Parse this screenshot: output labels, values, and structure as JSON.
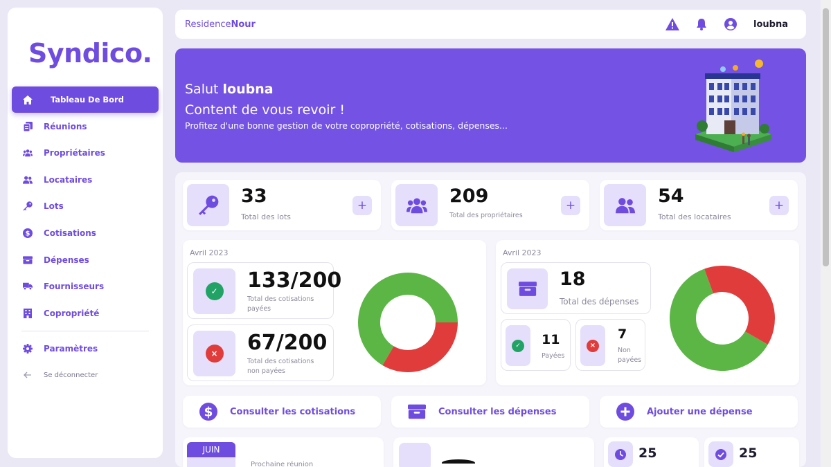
{
  "brand": {
    "logo": "Syndico."
  },
  "sidebar": {
    "items": [
      {
        "label": "Tableau De Bord",
        "icon": "home-icon",
        "active": true
      },
      {
        "label": "Réunions",
        "icon": "documents-icon"
      },
      {
        "label": "Propriétaires",
        "icon": "users-group-icon"
      },
      {
        "label": "Locataires",
        "icon": "users-icon"
      },
      {
        "label": "Lots",
        "icon": "key-icon"
      },
      {
        "label": "Cotisations",
        "icon": "dollar-circle-icon"
      },
      {
        "label": "Dépenses",
        "icon": "inbox-icon"
      },
      {
        "label": "Fournisseurs",
        "icon": "truck-icon"
      },
      {
        "label": "Copropriété",
        "icon": "building-icon"
      }
    ],
    "settings": "Paramètres",
    "logout": "Se déconnecter"
  },
  "topbar": {
    "residence_prefix": "Residence",
    "residence_name": "Nour",
    "username": "loubna"
  },
  "banner": {
    "greeting": "Salut",
    "name": "loubna",
    "subtitle": "Content de vous revoir !",
    "description": "Profitez d'une bonne gestion de votre copropriété, cotisations, dépenses..."
  },
  "stats": [
    {
      "value": "33",
      "label": "Total des lots",
      "icon": "key-icon"
    },
    {
      "value": "209",
      "label": "Total des propriétaires",
      "icon": "users-group-icon"
    },
    {
      "value": "54",
      "label": "Total des locataires",
      "icon": "users-icon"
    }
  ],
  "cotisations": {
    "month": "Avril 2023",
    "paid": {
      "value": "133/200",
      "label1": "Total des cotisations",
      "label2": "payées"
    },
    "unpaid": {
      "value": "67/200",
      "label1": "Total des cotisations",
      "label2": "non payées"
    },
    "donut": {
      "paid": 133,
      "unpaid": 67
    }
  },
  "depenses": {
    "month": "Avril 2023",
    "total": {
      "value": "18",
      "label": "Total des dépenses"
    },
    "paid": {
      "value": "11",
      "label": "Payées"
    },
    "unpaid": {
      "value": "7",
      "label1": "Non",
      "label2": "payées"
    },
    "donut": {
      "paid": 11,
      "unpaid": 7
    }
  },
  "actions": [
    {
      "label": "Consulter les cotisations",
      "icon": "dollar-circle-icon"
    },
    {
      "label": "Consulter les dépenses",
      "icon": "inbox-icon"
    },
    {
      "label": "Ajouter une dépense",
      "icon": "plus-circle-icon"
    }
  ],
  "bottom": {
    "month_badge": "JUIN",
    "meeting_label": "Prochaine réunion",
    "mini1": "25",
    "mini2": "25"
  },
  "colors": {
    "accent": "#6f4ce0",
    "banner": "#7352e4",
    "green": "#5cb645",
    "red": "#e03c3c"
  }
}
